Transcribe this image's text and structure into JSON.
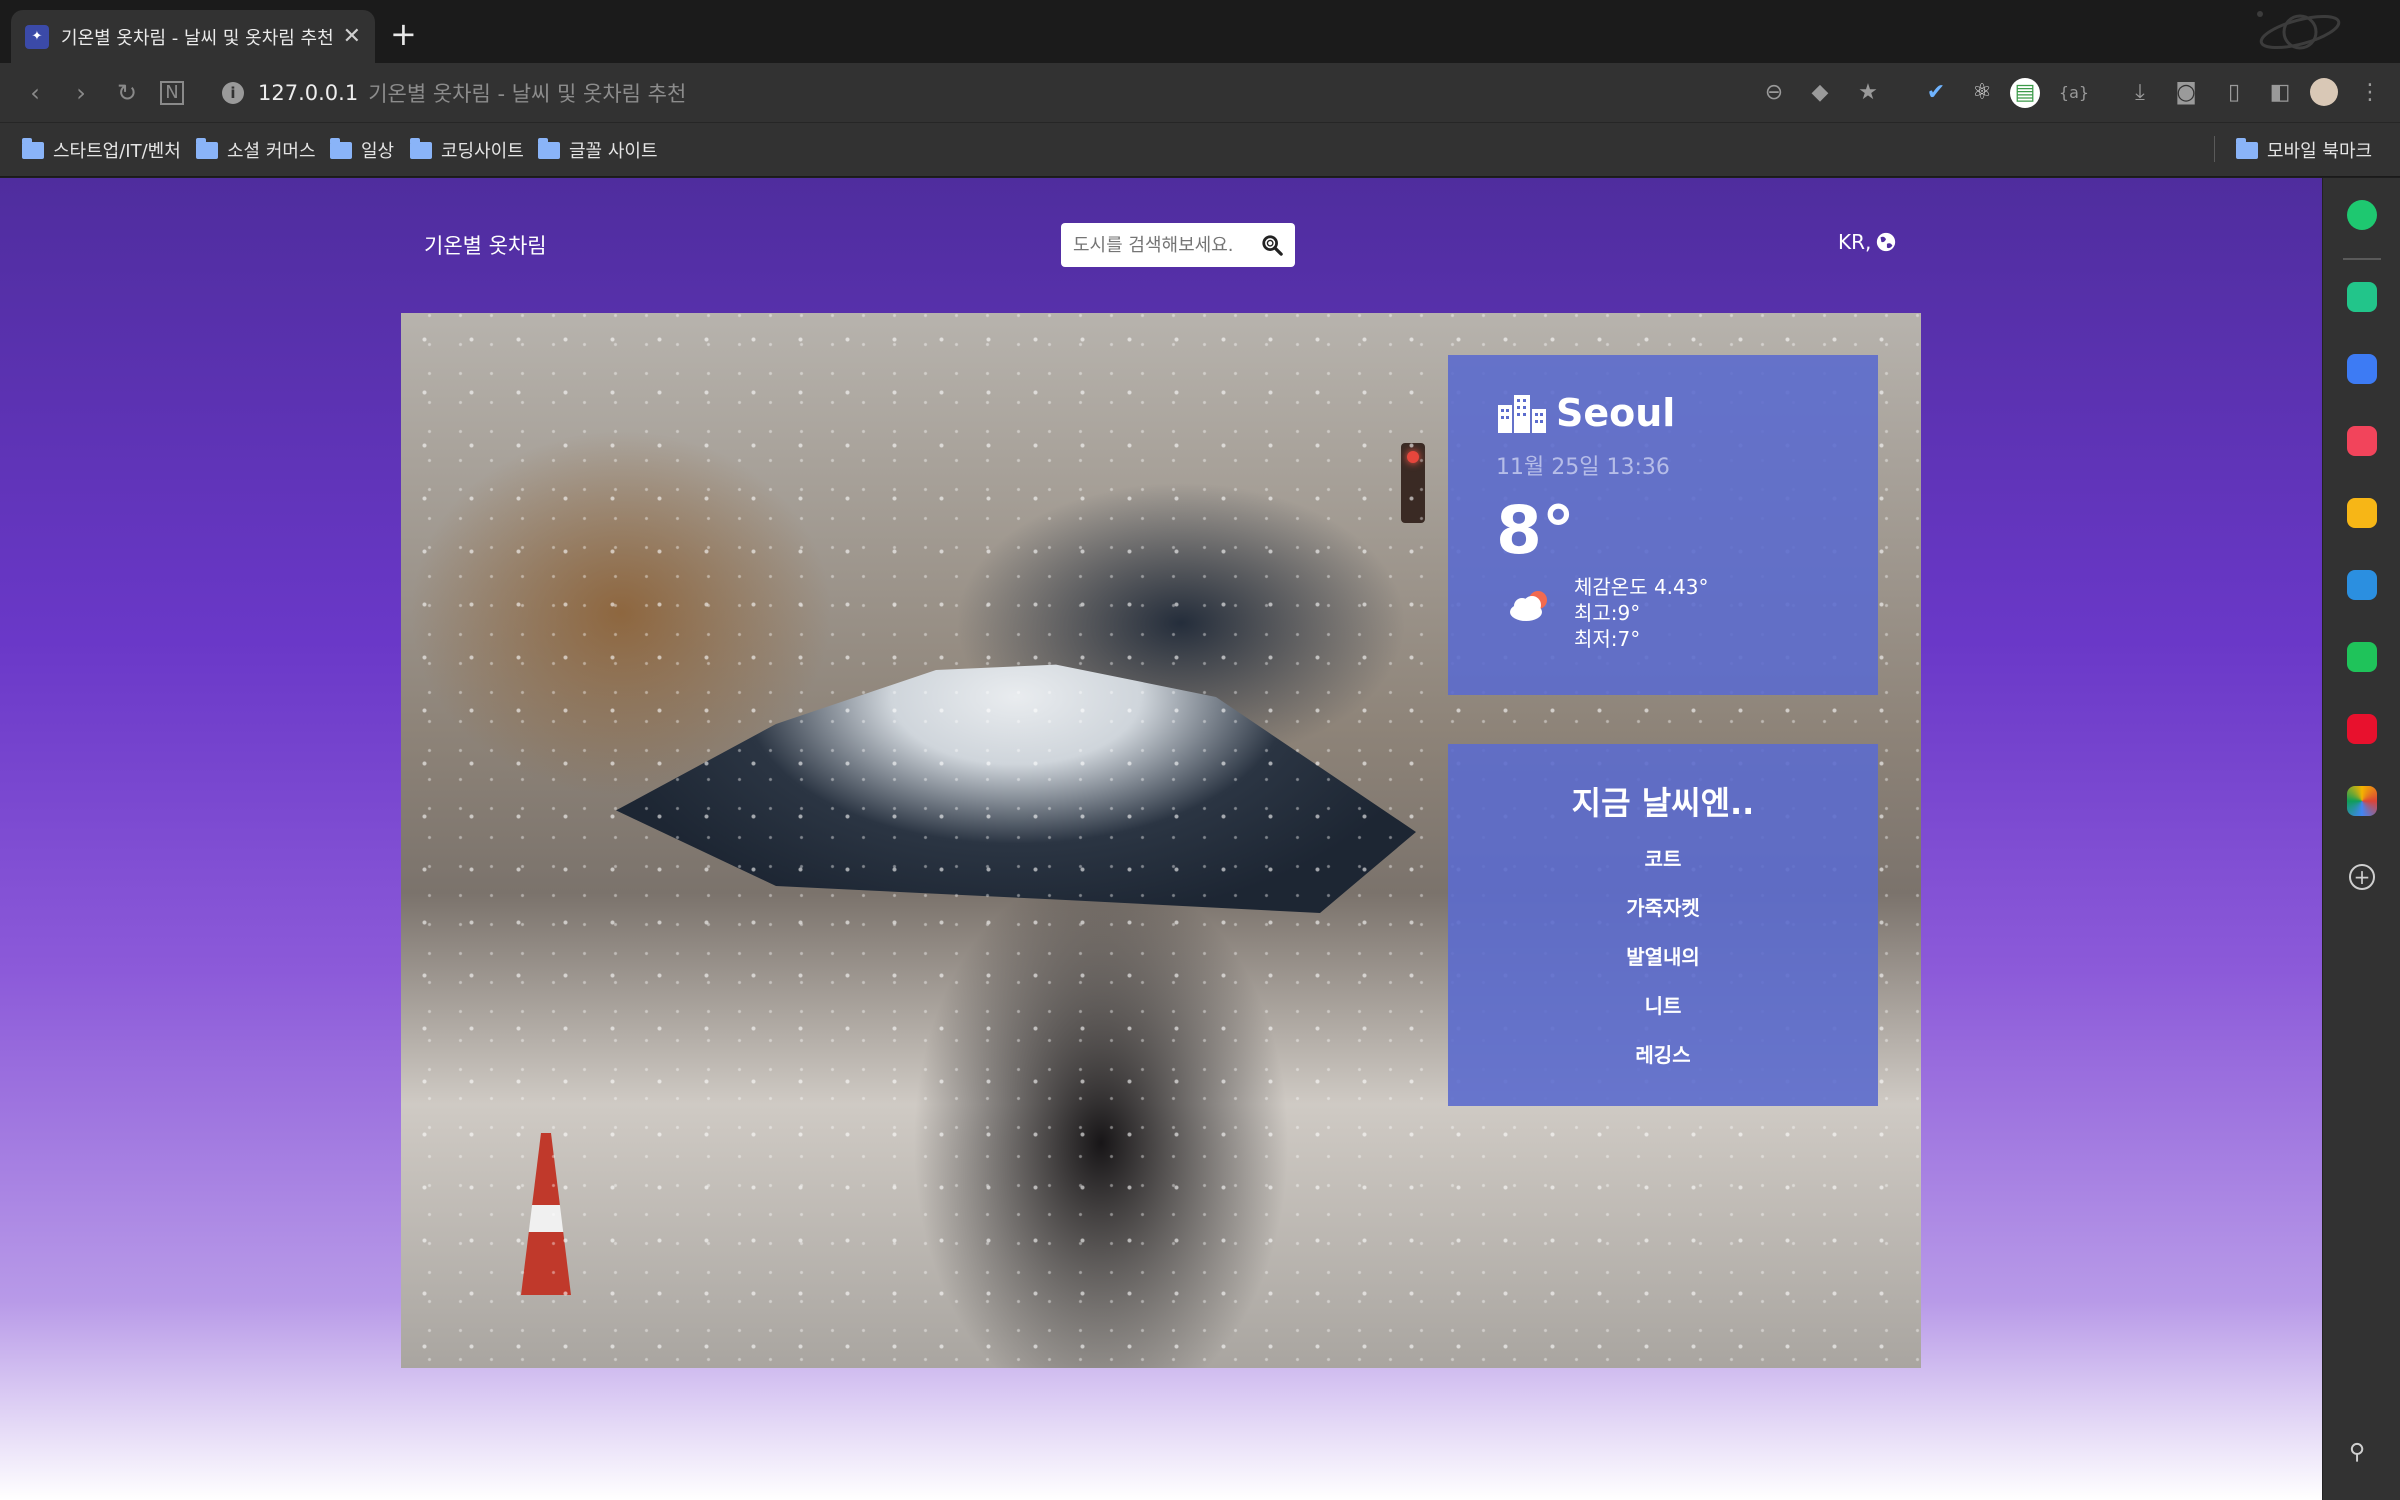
{
  "browser": {
    "tab_title": "기온별 옷차림 - 날씨 및 옷차림 추천",
    "new_tab_symbol": "+",
    "close_symbol": "✕",
    "address_host": "127.0.0.1",
    "address_title": "기온별 옷차림 - 날씨 및 옷차림 추천",
    "bookmarks": [
      "스타트업/IT/벤처",
      "소셜 커머스",
      "일상",
      "코딩사이트",
      "글꼴 사이트"
    ],
    "mobile_bookmarks": "모바일 북마크"
  },
  "page": {
    "brand": "기온별 옷차림",
    "search_placeholder": "도시를 검색해보세요.",
    "locale": "KR,"
  },
  "weather": {
    "city": "Seoul",
    "datetime": "11월 25일 13:36",
    "temp": "8°",
    "feels_like": "체감온도 4.43°",
    "high": "최고:9°",
    "low": "최저:7°",
    "icon": "cloud-sun-icon"
  },
  "outfit": {
    "title": "지금 날씨엔..",
    "items": [
      "코트",
      "가죽자켓",
      "발열내의",
      "니트",
      "레깅스"
    ]
  },
  "colors": {
    "card": "#5c6ccd",
    "bg_top": "#4f2d9e",
    "bg_bottom": "#b89ae8"
  }
}
